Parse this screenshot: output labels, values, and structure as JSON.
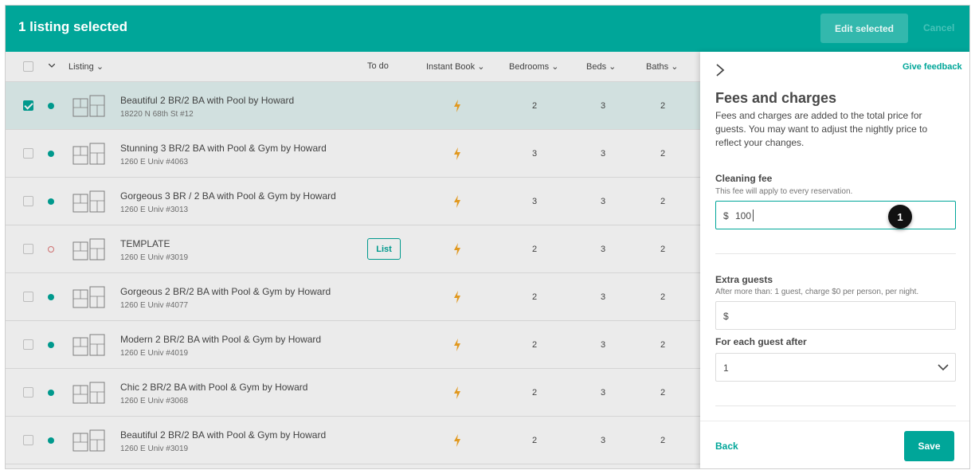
{
  "topbar": {
    "title": "1 listing selected",
    "edit_selected": "Edit selected",
    "cancel": "Cancel"
  },
  "table": {
    "headers": {
      "listing": "Listing",
      "todo": "To do",
      "instant_book": "Instant Book",
      "bedrooms": "Bedrooms",
      "beds": "Beds",
      "baths": "Baths"
    },
    "rows": [
      {
        "name": "Beautiful 2 BR/2 BA with Pool by Howard",
        "address": "18220 N 68th St #12",
        "bedrooms": "2",
        "beds": "3",
        "baths": "2",
        "selected": true,
        "status": "active"
      },
      {
        "name": "Stunning 3 BR/2 BA with Pool & Gym by Howard",
        "address": "1260 E Univ #4063",
        "bedrooms": "3",
        "beds": "3",
        "baths": "2",
        "selected": false,
        "status": "active"
      },
      {
        "name": "Gorgeous 3 BR / 2 BA with Pool & Gym by Howard",
        "address": "1260 E Univ #3013",
        "bedrooms": "3",
        "beds": "3",
        "baths": "2",
        "selected": false,
        "status": "active"
      },
      {
        "name": "TEMPLATE",
        "address": "1260 E Univ #3019",
        "bedrooms": "2",
        "beds": "3",
        "baths": "2",
        "selected": false,
        "status": "unlisted",
        "todo": "List"
      },
      {
        "name": "Gorgeous 2 BR/2 BA with Pool & Gym by Howard",
        "address": "1260 E Univ #4077",
        "bedrooms": "2",
        "beds": "3",
        "baths": "2",
        "selected": false,
        "status": "active"
      },
      {
        "name": "Modern 2 BR/2 BA with Pool & Gym by Howard",
        "address": "1260 E Univ #4019",
        "bedrooms": "2",
        "beds": "3",
        "baths": "2",
        "selected": false,
        "status": "active"
      },
      {
        "name": "Chic 2 BR/2 BA with Pool & Gym by Howard",
        "address": "1260 E Univ #3068",
        "bedrooms": "2",
        "beds": "3",
        "baths": "2",
        "selected": false,
        "status": "active"
      },
      {
        "name": "Beautiful 2 BR/2 BA with Pool & Gym by Howard",
        "address": "1260 E Univ #3019",
        "bedrooms": "2",
        "beds": "3",
        "baths": "2",
        "selected": false,
        "status": "active"
      }
    ]
  },
  "panel": {
    "give_feedback": "Give feedback",
    "title": "Fees and charges",
    "description": "Fees and charges are added to the total price for guests. You may want to adjust the nightly price to reflect your changes.",
    "cleaning_fee": {
      "label": "Cleaning fee",
      "sublabel": "This fee will apply to every reservation.",
      "currency": "$",
      "value": "100"
    },
    "extra_guests": {
      "label": "Extra guests",
      "sublabel": "After more than: 1 guest, charge $0 per person, per night.",
      "currency": "$",
      "value": ""
    },
    "each_guest_after": {
      "label": "For each guest after",
      "value": "1"
    },
    "back": "Back",
    "save": "Save"
  },
  "annotation": {
    "step": "1"
  },
  "colors": {
    "accent": "#00a699",
    "badge": "#111111"
  }
}
